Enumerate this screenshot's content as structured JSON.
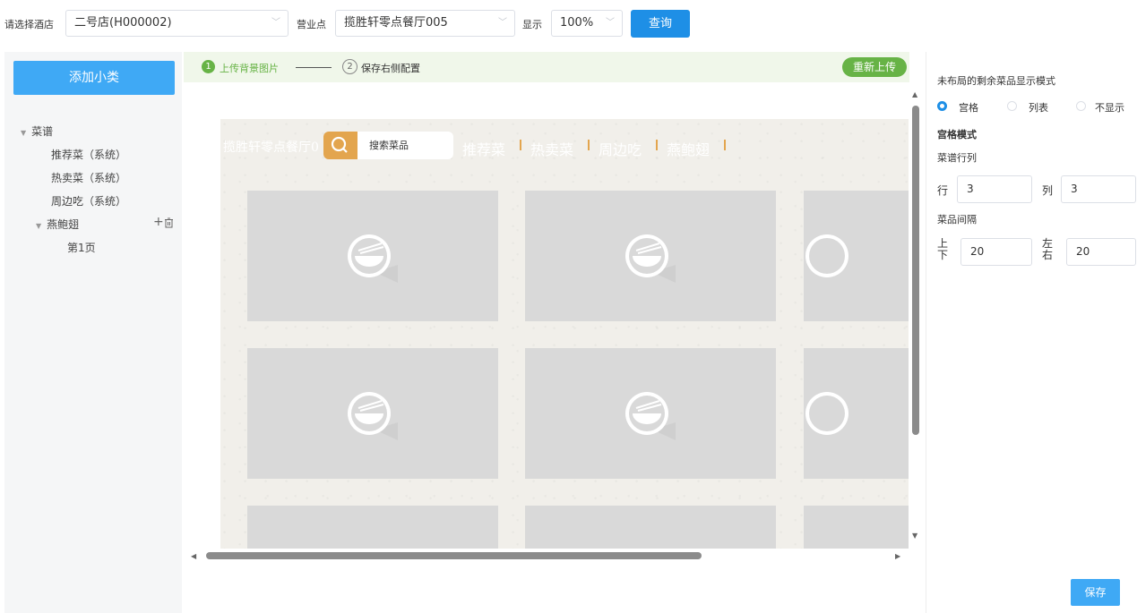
{
  "toolbar": {
    "hotel_label": "请选择酒店",
    "hotel_value": "二号店(H000002)",
    "outlet_label": "营业点",
    "outlet_value": "揽胜轩零点餐厅005",
    "display_label": "显示",
    "display_value": "100%",
    "query_label": "查询"
  },
  "sidebar": {
    "add_label": "添加小类",
    "root": "菜谱",
    "items": [
      "推荐菜（系统）",
      "热卖菜（系统）",
      "周边吃（系统）"
    ],
    "custom_category": "燕鲍翅",
    "page": "第1页"
  },
  "steps": {
    "step1_num": "1",
    "step1_label": "上传背景图片",
    "step2_num": "2",
    "step2_label": "保存右侧配置",
    "reupload_label": "重新上传"
  },
  "preview": {
    "restaurant_name": "揽胜轩零点餐厅0",
    "search_placeholder": "搜索菜品",
    "nav": [
      "推荐菜",
      "热卖菜",
      "周边吃",
      "燕鲍翅"
    ],
    "accent": "#e3a54e"
  },
  "settings": {
    "mode_title": "未布局的剩余菜品显示模式",
    "options": [
      "宫格",
      "列表",
      "不显示"
    ],
    "selected": "宫格",
    "grid_title": "宫格模式",
    "rowcol_title": "菜谱行列",
    "row_label": "行",
    "row_value": "3",
    "col_label": "列",
    "col_value": "3",
    "spacing_title": "菜品间隔",
    "vertical_label": "上下",
    "vertical_value": "20",
    "horizontal_label": "左右",
    "horizontal_value": "20",
    "save_label": "保存"
  },
  "colors": {
    "primary": "#1e8fe6",
    "button_blue": "#3fa9f5",
    "step_green": "#67b346"
  }
}
